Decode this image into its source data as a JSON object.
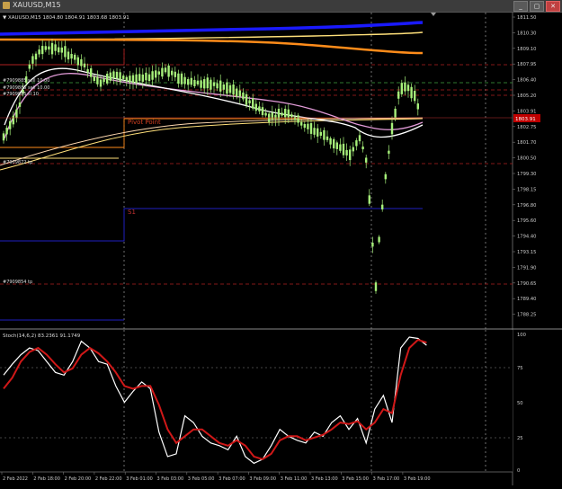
{
  "window": {
    "title": "XAUUSD,M15",
    "buttons": [
      "_",
      "▢",
      "✕"
    ]
  },
  "chart": {
    "header": "▼ XAUUSD,M15  1804.80 1804.91 1803.68 1803.91",
    "price_labels": [
      "1811.50",
      "1810.30",
      "1809.10",
      "1807.95",
      "1806.40",
      "1805.20",
      "1803.91",
      "1802.75",
      "1801.70",
      "1800.50",
      "1799.30",
      "1798.15",
      "1796.80",
      "1795.60",
      "1794.40",
      "1793.15",
      "1791.90",
      "1790.65",
      "1789.40",
      "1788.25"
    ],
    "current_price": "1803.91",
    "annotations": {
      "pivot": "Pivot Point",
      "s1": "S1",
      "order1": "#7909885 sell 10.00",
      "order2": "#7909885 sell 10.00",
      "order3": "#7909885 sl 10",
      "order_tp1": "#7909872 tp",
      "order_tp2": "#7909854 tp"
    }
  },
  "stoch": {
    "header": "Stoch(14,6,2) 83.2361 91.1749",
    "levels": [
      "100",
      "75",
      "50",
      "25",
      "0"
    ]
  },
  "time_axis": [
    "2 Feb 2022",
    "2 Feb 18:00",
    "2 Feb 20:00",
    "2 Feb 22:00",
    "3 Feb 01:00",
    "3 Feb 03:00",
    "3 Feb 05:00",
    "3 Feb 07:00",
    "3 Feb 09:00",
    "3 Feb 11:00",
    "3 Feb 13:00",
    "3 Feb 15:00",
    "3 Feb 17:00",
    "3 Feb 19:00"
  ],
  "colors": {
    "candle": "#a6f07a",
    "ma_blue": "#1a1aff",
    "ma_orange": "#ff8c1a",
    "ma_yellow": "#ffe07a",
    "ma_white": "#ffffff",
    "ma_pink": "#e29bd8",
    "stoch_main": "#ffffff",
    "stoch_signal": "#d01818",
    "current_price_bg": "#c00000"
  }
}
